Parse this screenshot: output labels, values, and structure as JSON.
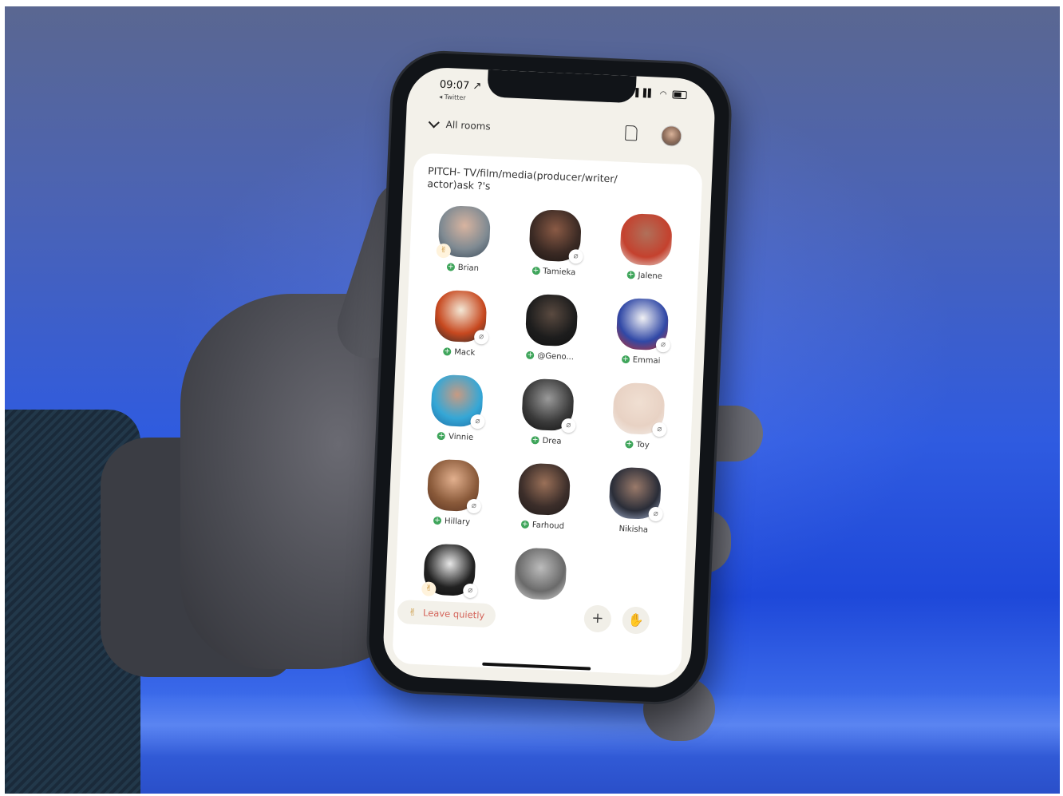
{
  "status_bar": {
    "time": "09:07 ↗",
    "back_app": "◂ Twitter",
    "indicators": "▐▐▌ ◠"
  },
  "topbar": {
    "all_rooms_label": "All rooms",
    "icons": [
      "chevron-down-icon",
      "document-icon",
      "profile-avatar"
    ]
  },
  "room": {
    "title": "PITCH- TV/film/media(producer/writer/ actor)ask ?'s"
  },
  "speakers": [
    {
      "name": "Brian",
      "follow": true,
      "muted": false,
      "hand": true,
      "colors": [
        "#d8b4a0",
        "#7f8a92",
        "#3a4a5a"
      ]
    },
    {
      "name": "Tamieka",
      "follow": true,
      "muted": true,
      "hand": false,
      "colors": [
        "#8a5a45",
        "#3b2a24",
        "#1a1513"
      ]
    },
    {
      "name": "Jalene",
      "follow": true,
      "muted": false,
      "hand": false,
      "colors": [
        "#b0705a",
        "#c4412e",
        "#e8e2dc"
      ]
    },
    {
      "name": "Mack",
      "follow": true,
      "muted": true,
      "hand": false,
      "colors": [
        "#f3e8d6",
        "#c7481f",
        "#2a2a2a"
      ]
    },
    {
      "name": "@Geno...",
      "follow": true,
      "muted": false,
      "hand": false,
      "colors": [
        "#5a4a40",
        "#1d1d1d",
        "#111111"
      ]
    },
    {
      "name": "Emmai",
      "follow": true,
      "muted": true,
      "hand": false,
      "colors": [
        "#f1f1f4",
        "#3048a6",
        "#c7302a"
      ]
    },
    {
      "name": "Vinnie",
      "follow": true,
      "muted": true,
      "hand": false,
      "colors": [
        "#c89a82",
        "#35a7d6",
        "#1d6ea6"
      ]
    },
    {
      "name": "Drea",
      "follow": true,
      "muted": true,
      "hand": false,
      "colors": [
        "#9a9a9a",
        "#3a3a3a",
        "#111111"
      ]
    },
    {
      "name": "Toy",
      "follow": true,
      "muted": true,
      "hand": false,
      "colors": [
        "#f0dfd2",
        "#e8d2c4",
        "#f4f0ec"
      ]
    },
    {
      "name": "Hillary",
      "follow": true,
      "muted": true,
      "hand": false,
      "colors": [
        "#e2b08e",
        "#8a5a3a",
        "#5a3422"
      ]
    },
    {
      "name": "Farhoud",
      "follow": true,
      "muted": false,
      "hand": false,
      "colors": [
        "#9a7058",
        "#3c2e2a",
        "#1f1b1a"
      ]
    },
    {
      "name": "Nikisha",
      "follow": false,
      "muted": true,
      "hand": false,
      "colors": [
        "#9a7a6a",
        "#2a2d38",
        "#a8b6d6"
      ]
    },
    {
      "name": "",
      "follow": false,
      "muted": true,
      "hand": true,
      "colors": [
        "#e8e8e8",
        "#222222",
        "#0d0d0d"
      ]
    },
    {
      "name": "",
      "follow": false,
      "muted": false,
      "hand": false,
      "colors": [
        "#bcbcbc",
        "#6a6a6a",
        "#d9d9d9"
      ]
    }
  ],
  "bottom_bar": {
    "leave_emoji": "✌",
    "leave_label": "Leave quietly",
    "add_label": "+",
    "raise_hand_icon": "✋"
  },
  "colors": {
    "screen_bg": "#f3f1ea",
    "follow_green": "#3fa55b",
    "leave_red": "#d4645a"
  }
}
